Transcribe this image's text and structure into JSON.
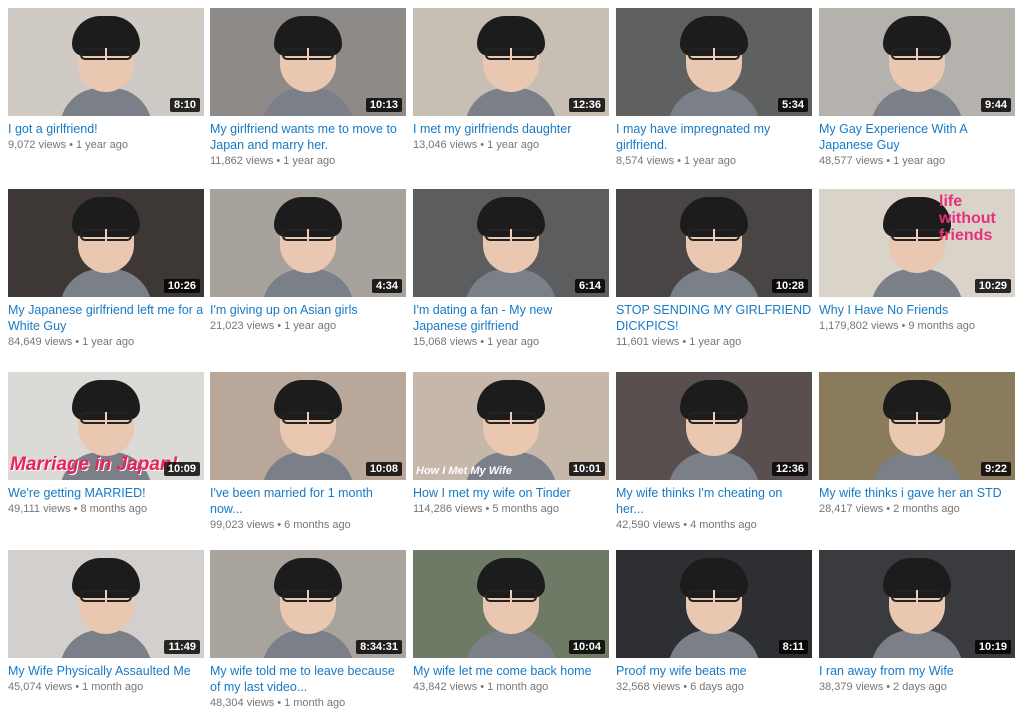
{
  "colors": {
    "title_link": "#167ac6",
    "meta_text": "#767676",
    "duration_bg": "#000000"
  },
  "videos": [
    {
      "title": "I got a girlfriend!",
      "views": "9,072 views",
      "age": "1 year ago",
      "duration": "8:10",
      "bg": "#cfcac4"
    },
    {
      "title": "My girlfriend wants me to move to Japan and marry her.",
      "views": "11,862 views",
      "age": "1 year ago",
      "duration": "10:13",
      "bg": "#8e8a87"
    },
    {
      "title": "I met my girlfriends daughter",
      "views": "13,046 views",
      "age": "1 year ago",
      "duration": "12:36",
      "bg": "#c8bfb4"
    },
    {
      "title": "I may have impregnated my girlfriend.",
      "views": "8,574 views",
      "age": "1 year ago",
      "duration": "5:34",
      "bg": "#5f6160"
    },
    {
      "title": "My Gay Experience With A Japanese Guy",
      "views": "48,577 views",
      "age": "1 year ago",
      "duration": "9:44",
      "bg": "#b5b2ad"
    },
    {
      "title": "My Japanese girlfriend left me for a White Guy",
      "views": "84,649 views",
      "age": "1 year ago",
      "duration": "10:26",
      "bg": "#3d3836"
    },
    {
      "title": "I'm giving up on Asian girls",
      "views": "21,023 views",
      "age": "1 year ago",
      "duration": "4:34",
      "bg": "#a7a39c"
    },
    {
      "title": "I'm dating a fan - My new Japanese girlfriend",
      "views": "15,068 views",
      "age": "1 year ago",
      "duration": "6:14",
      "bg": "#5b5d5f"
    },
    {
      "title": "STOP SENDING MY GIRLFRIEND DICKPICS!",
      "views": "11,601 views",
      "age": "1 year ago",
      "duration": "10:28",
      "bg": "#4a4545"
    },
    {
      "title": "Why I Have No Friends",
      "views": "1,179,802 views",
      "age": "9 months ago",
      "duration": "10:29",
      "bg": "#d9d3c9",
      "overlay": "life without friends"
    },
    {
      "title": "We're getting MARRIED!",
      "views": "49,111 views",
      "age": "8 months ago",
      "duration": "10:09",
      "bg": "#dcdad6",
      "overlay": "Marriage in Japan!"
    },
    {
      "title": "I've been married for 1 month now...",
      "views": "99,023 views",
      "age": "6 months ago",
      "duration": "10:08",
      "bg": "#b9a89a"
    },
    {
      "title": "How I met my wife on Tinder",
      "views": "114,286 views",
      "age": "5 months ago",
      "duration": "10:01",
      "bg": "#c5b7a9",
      "overlay": "How I Met My Wife"
    },
    {
      "title": "My wife thinks I'm cheating on her...",
      "views": "42,590 views",
      "age": "4 months ago",
      "duration": "12:36",
      "bg": "#5a4f4f"
    },
    {
      "title": "My wife thinks i gave her an STD",
      "views": "28,417 views",
      "age": "2 months ago",
      "duration": "9:22",
      "bg": "#8a7b5d"
    },
    {
      "title": "My Wife Physically Assaulted Me",
      "views": "45,074 views",
      "age": "1 month ago",
      "duration": "11:49",
      "bg": "#d2cfcc"
    },
    {
      "title": "My wife told me to leave because of my last video...",
      "views": "48,304 views",
      "age": "1 month ago",
      "duration": "8:34:31",
      "bg": "#a9a39e"
    },
    {
      "title": "My wife let me come back home",
      "views": "43,842 views",
      "age": "1 month ago",
      "duration": "10:04",
      "bg": "#6f7a66"
    },
    {
      "title": "Proof my wife beats me",
      "views": "32,568 views",
      "age": "6 days ago",
      "duration": "8:11",
      "bg": "#2e2f33"
    },
    {
      "title": "I ran away from my Wife",
      "views": "38,379 views",
      "age": "2 days ago",
      "duration": "10:19",
      "bg": "#3a3b3f"
    }
  ]
}
